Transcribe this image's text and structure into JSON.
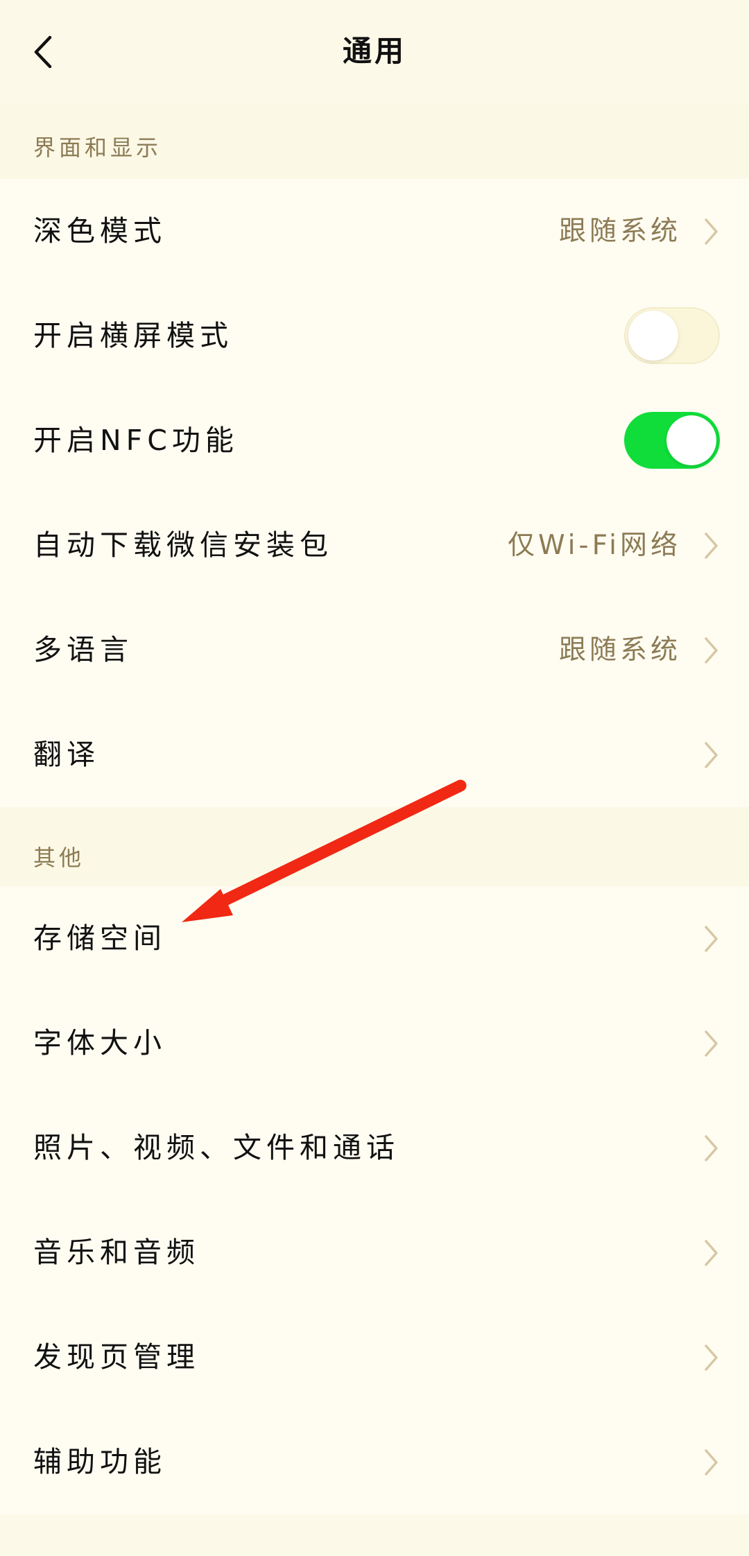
{
  "header": {
    "title": "通用",
    "back_icon": "chevron-left-icon"
  },
  "colors": {
    "page_background": "#FDF9E8",
    "row_background": "#FFFDF2",
    "section_label": "#8C7B55",
    "value_text": "#8C7B55",
    "chevron": "#D8C7A4",
    "toggle_on": "#10DD3A",
    "toggle_off": "#FBF6D9",
    "annotation_arrow": "#F02814"
  },
  "sections": {
    "display": {
      "label": "界面和显示",
      "items": [
        {
          "title": "深色模式",
          "value": "跟随系统",
          "chevron": true
        },
        {
          "title": "开启横屏模式",
          "toggle": false
        },
        {
          "title": "开启NFC功能",
          "toggle": true
        },
        {
          "title": "自动下载微信安装包",
          "value": "仅Wi-Fi网络",
          "chevron": true
        },
        {
          "title": "多语言",
          "value": "跟随系统",
          "chevron": true
        },
        {
          "title": "翻译",
          "chevron": true
        }
      ]
    },
    "other": {
      "label": "其他",
      "items": [
        {
          "title": "存储空间",
          "chevron": true
        },
        {
          "title": "字体大小",
          "chevron": true
        },
        {
          "title": "照片、视频、文件和通话",
          "chevron": true
        },
        {
          "title": "音乐和音频",
          "chevron": true
        },
        {
          "title": "发现页管理",
          "chevron": true
        },
        {
          "title": "辅助功能",
          "chevron": true
        }
      ]
    }
  }
}
